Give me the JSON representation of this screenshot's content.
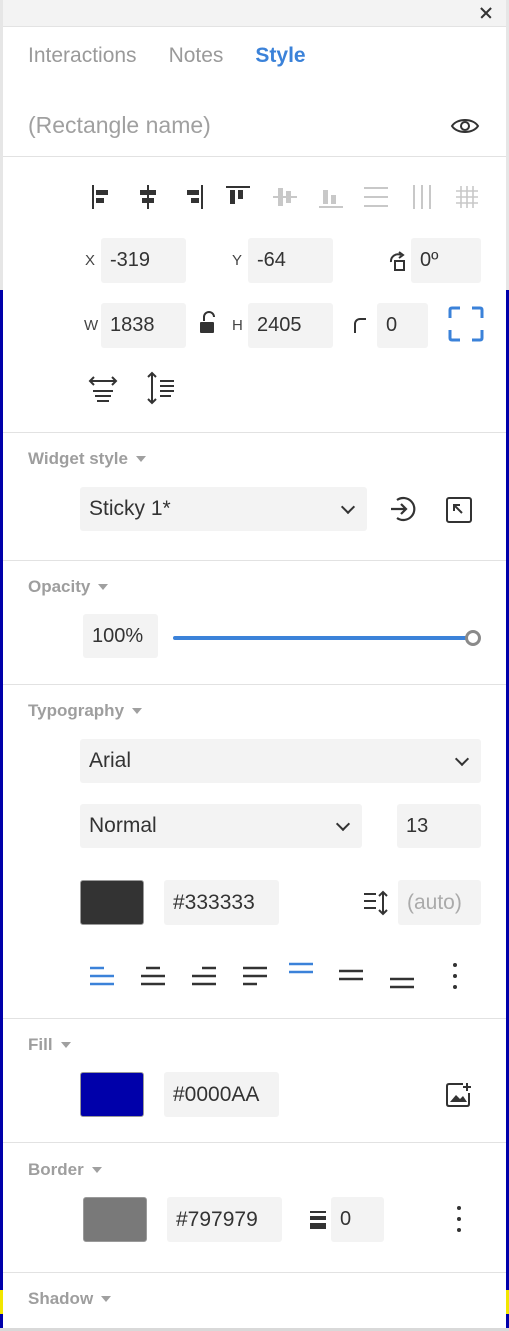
{
  "tabs": [
    {
      "label": "Interactions",
      "active": false
    },
    {
      "label": "Notes",
      "active": false
    },
    {
      "label": "Style",
      "active": true
    }
  ],
  "name": {
    "placeholder": "(Rectangle name)"
  },
  "geometry": {
    "x_label": "X",
    "x_value": "-319",
    "y_label": "Y",
    "y_value": "-64",
    "rotation_value": "0º",
    "w_label": "W",
    "w_value": "1838",
    "h_label": "H",
    "h_value": "2405",
    "corner_value": "0"
  },
  "widget_style": {
    "title": "Widget style",
    "selected": "Sticky 1*"
  },
  "opacity": {
    "title": "Opacity",
    "value": "100%",
    "level": 1.0
  },
  "typography": {
    "title": "Typography",
    "font": "Arial",
    "weight": "Normal",
    "size": "13",
    "color_hex": "#333333",
    "color": "#333333",
    "line_height_placeholder": "(auto)"
  },
  "fill": {
    "title": "Fill",
    "color_hex": "#0000AA",
    "color": "#0000AA"
  },
  "border": {
    "title": "Border",
    "color_hex": "#797979",
    "color": "#797979",
    "width": "0"
  },
  "shadow": {
    "title": "Shadow"
  },
  "colors": {
    "accent": "#3b82d9",
    "canvas_fill": "#0000aa"
  }
}
